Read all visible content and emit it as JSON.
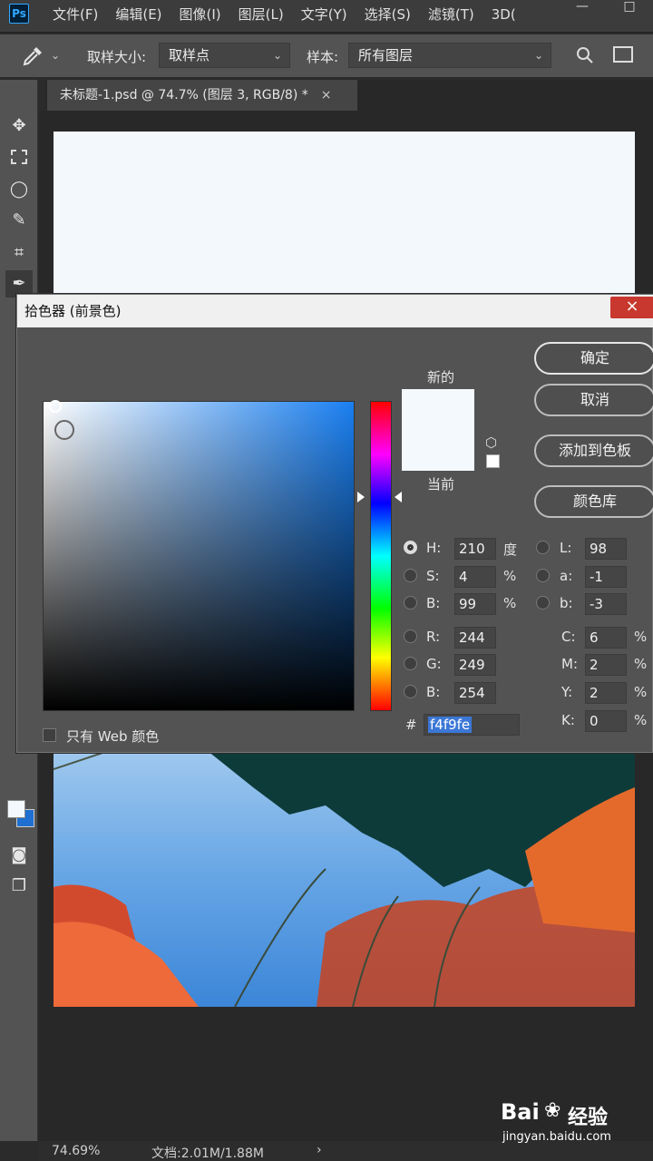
{
  "app": {
    "logo": "Ps"
  },
  "menu": [
    "文件(F)",
    "编辑(E)",
    "图像(I)",
    "图层(L)",
    "文字(Y)",
    "选择(S)",
    "滤镜(T)",
    "3D("
  ],
  "window_controls": [
    "—",
    "□"
  ],
  "options": {
    "sample_size_label": "取样大小:",
    "sample_size_value": "取样点",
    "sample_label": "样本:",
    "sample_value": "所有图层"
  },
  "document": {
    "tab_title": "未标题-1.psd @ 74.7% (图层 3, RGB/8) *",
    "close": "×"
  },
  "status": {
    "zoom": "74.69%",
    "doc_size": "文档:2.01M/1.88M",
    "arrow": "›"
  },
  "dialog": {
    "title": "拾色器 (前景色)",
    "close": "×",
    "buttons": {
      "ok": "确定",
      "cancel": "取消",
      "add_swatch": "添加到色板",
      "libraries": "颜色库"
    },
    "new_label": "新的",
    "current_label": "当前",
    "new_color": "#f4f9fe",
    "current_color": "#f4f9fe",
    "web_only_label": "只有 Web 颜色",
    "hsb": {
      "h_label": "H:",
      "h": "210",
      "h_unit": "度",
      "s_label": "S:",
      "s": "4",
      "s_unit": "%",
      "b_label": "B:",
      "b": "99",
      "b_unit": "%"
    },
    "rgb": {
      "r_label": "R:",
      "r": "244",
      "g_label": "G:",
      "g": "249",
      "b_label": "B:",
      "b": "254"
    },
    "lab": {
      "l_label": "L:",
      "l": "98",
      "a_label": "a:",
      "a": "-1",
      "b_label": "b:",
      "b": "-3"
    },
    "cmyk": {
      "c_label": "C:",
      "c": "6",
      "m_label": "M:",
      "m": "2",
      "y_label": "Y:",
      "y": "2",
      "k_label": "K:",
      "k": "0",
      "unit": "%"
    },
    "hex_label": "#",
    "hex": "f4f9fe"
  },
  "watermark": {
    "brand": "Bai",
    "brand2": "经验",
    "url": "jingyan.baidu.com"
  }
}
